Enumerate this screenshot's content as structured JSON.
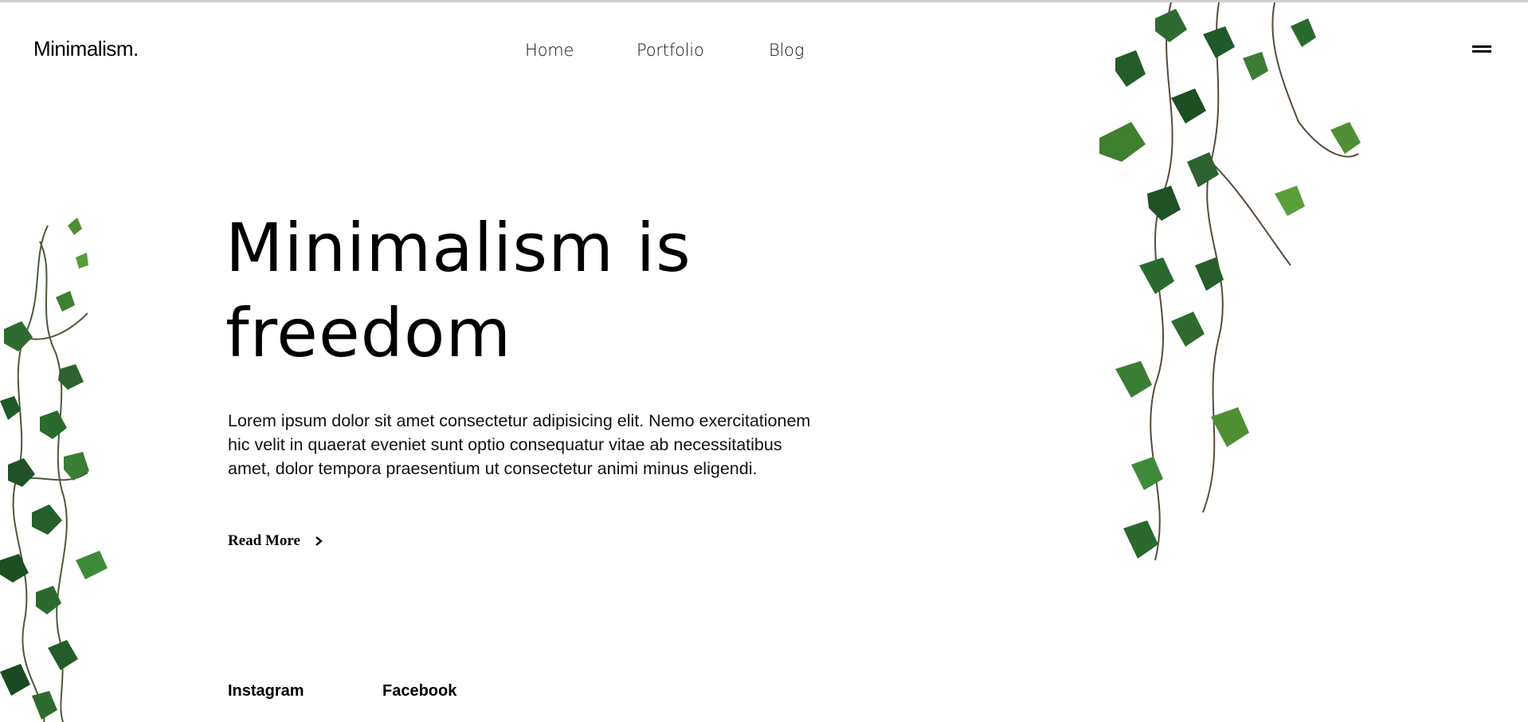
{
  "brand": {
    "logo": "Minimalism."
  },
  "nav": {
    "items": [
      "Home",
      "Portfolio",
      "Blog"
    ]
  },
  "menu": {
    "icon": "hamburger-menu-icon"
  },
  "hero": {
    "title_line1": "Minimalism is",
    "title_line2": "freedom",
    "text_line1": "Lorem ipsum dolor sit amet consectetur adipisicing elit. Nemo exercitationem",
    "text_line2": "hic velit in quaerat eveniet sunt optio consequatur vitae ab necessitatibus",
    "text_line3": "amet, dolor tempora praesentium ut consectetur animi minus eligendi.",
    "read_more": "Read More",
    "read_more_icon": "chevron-right-icon"
  },
  "social": {
    "instagram": "Instagram",
    "facebook": "Facebook"
  },
  "decor": {
    "left": "ivy-vine-left-image",
    "right": "ivy-vine-right-image"
  },
  "colors": {
    "text": "#000000",
    "background": "#ffffff",
    "leaf_dark": "#1f5a2a",
    "leaf_light": "#5a9e3a"
  }
}
